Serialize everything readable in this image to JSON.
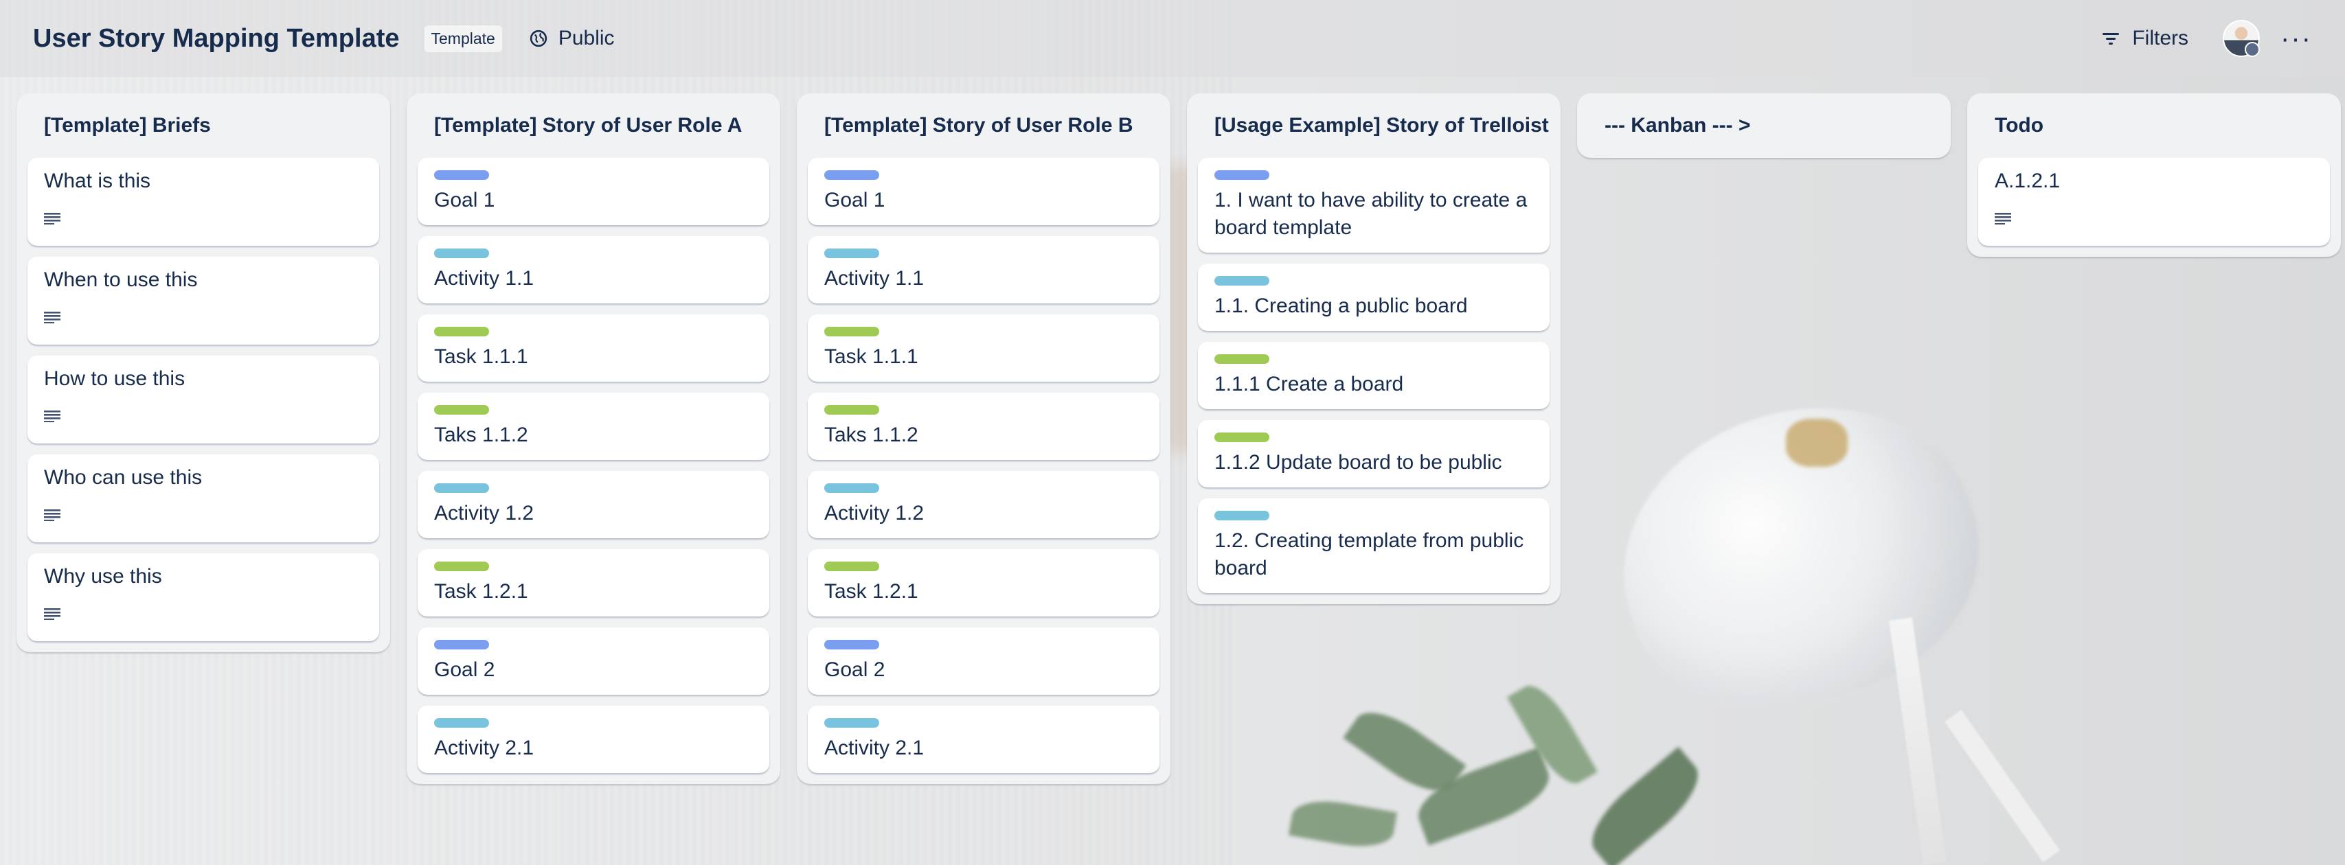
{
  "colors": {
    "goal": "#7b9ff0",
    "activity": "#79c3de",
    "task": "#9fcb55"
  },
  "header": {
    "title": "User Story Mapping Template",
    "template_badge": "Template",
    "visibility": "Public",
    "filters": "Filters",
    "more": "···"
  },
  "lists": [
    {
      "title": "[Template] Briefs",
      "cards": [
        {
          "text": "What is this",
          "label": null,
          "has_description": true
        },
        {
          "text": "When to use this",
          "label": null,
          "has_description": true
        },
        {
          "text": "How to use this",
          "label": null,
          "has_description": true
        },
        {
          "text": "Who can use this",
          "label": null,
          "has_description": true
        },
        {
          "text": "Why use this",
          "label": null,
          "has_description": true
        }
      ]
    },
    {
      "title": "[Template] Story of User Role A",
      "cards": [
        {
          "text": "Goal 1",
          "label": "goal"
        },
        {
          "text": "Activity 1.1",
          "label": "activity"
        },
        {
          "text": "Task 1.1.1",
          "label": "task"
        },
        {
          "text": "Taks 1.1.2",
          "label": "task"
        },
        {
          "text": "Activity 1.2",
          "label": "activity"
        },
        {
          "text": "Task 1.2.1",
          "label": "task"
        },
        {
          "text": "Goal 2",
          "label": "goal"
        },
        {
          "text": "Activity 2.1",
          "label": "activity"
        }
      ]
    },
    {
      "title": "[Template] Story of User Role B",
      "cards": [
        {
          "text": "Goal 1",
          "label": "goal"
        },
        {
          "text": "Activity 1.1",
          "label": "activity"
        },
        {
          "text": "Task 1.1.1",
          "label": "task"
        },
        {
          "text": "Taks 1.1.2",
          "label": "task"
        },
        {
          "text": "Activity 1.2",
          "label": "activity"
        },
        {
          "text": "Task 1.2.1",
          "label": "task"
        },
        {
          "text": "Goal 2",
          "label": "goal"
        },
        {
          "text": "Activity 2.1",
          "label": "activity"
        }
      ]
    },
    {
      "title": "[Usage Example] Story of Trelloist",
      "cards": [
        {
          "text": "1. I want to have ability to create a board template",
          "label": "goal"
        },
        {
          "text": "1.1. Creating a public board",
          "label": "activity"
        },
        {
          "text": "1.1.1 Create a board",
          "label": "task"
        },
        {
          "text": "1.1.2 Update board to be public",
          "label": "task"
        },
        {
          "text": "1.2. Creating template from public board",
          "label": "activity"
        }
      ]
    },
    {
      "title": "--- Kanban --- >",
      "cards": []
    },
    {
      "title": "Todo",
      "cards": [
        {
          "text": "A.1.2.1",
          "label": null,
          "has_description": true
        }
      ]
    }
  ]
}
